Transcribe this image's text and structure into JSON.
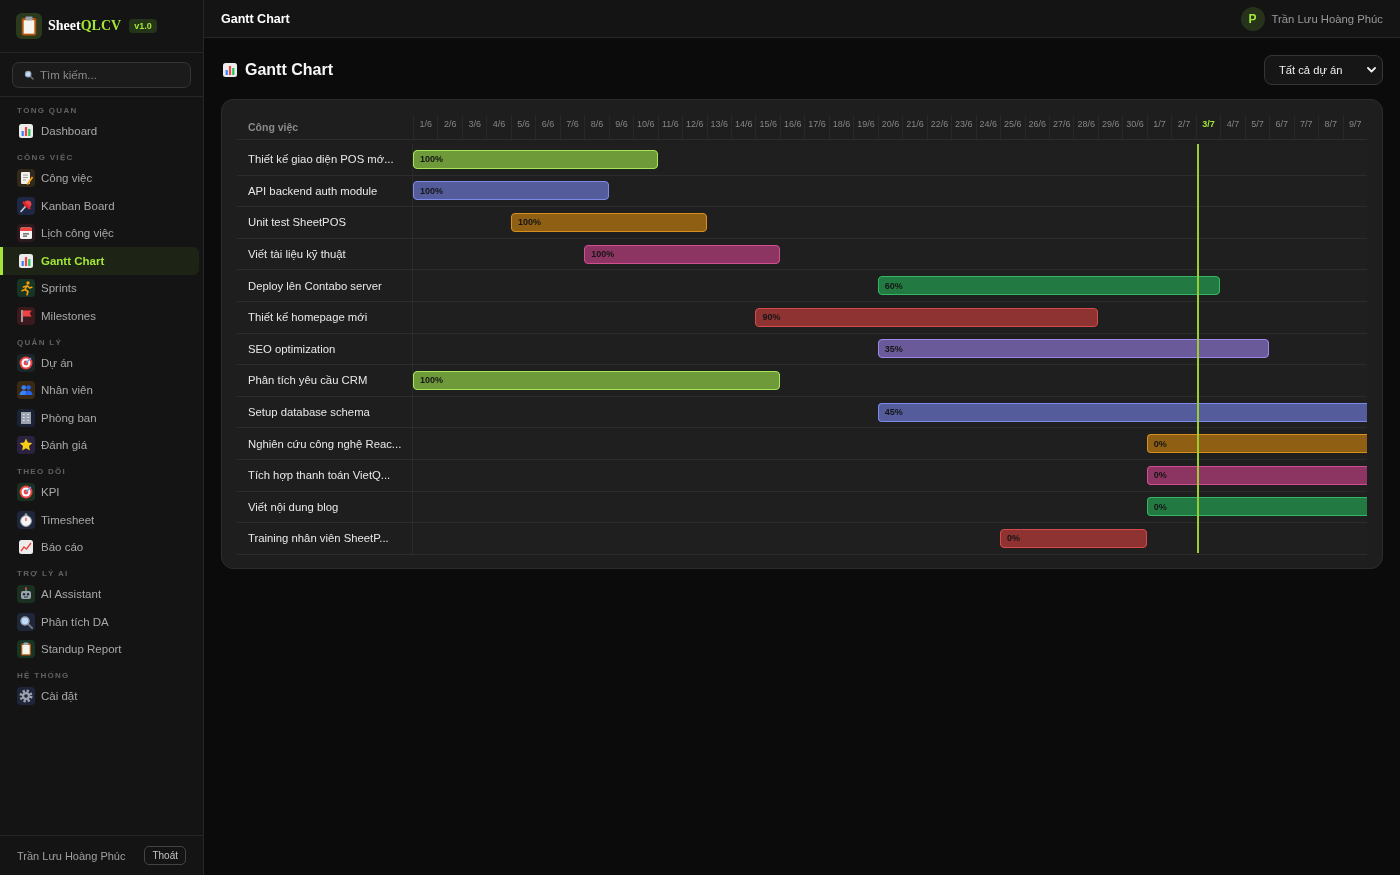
{
  "sidebar": {
    "brand": {
      "name": "Sheet",
      "accent": "QLCV",
      "version": "v1.0"
    },
    "search": {
      "placeholder": "Tìm kiếm..."
    },
    "sections": [
      {
        "title": "TỔNG QUAN",
        "items": [
          {
            "label": "Dashboard",
            "selected": false
          }
        ]
      },
      {
        "title": "CÔNG VIỆC",
        "items": [
          {
            "label": "Công việc",
            "selected": false
          },
          {
            "label": "Kanban Board",
            "selected": false
          },
          {
            "label": "Lịch công việc",
            "selected": false
          },
          {
            "label": "Gantt Chart",
            "selected": true
          },
          {
            "label": "Sprints",
            "selected": false
          },
          {
            "label": "Milestones",
            "selected": false
          }
        ]
      },
      {
        "title": "QUẢN LÝ",
        "items": [
          {
            "label": "Dự án",
            "selected": false
          },
          {
            "label": "Nhân viên",
            "selected": false
          },
          {
            "label": "Phòng ban",
            "selected": false
          },
          {
            "label": "Đánh giá",
            "selected": false
          }
        ]
      },
      {
        "title": "THEO DÕI",
        "items": [
          {
            "label": "KPI",
            "selected": false
          },
          {
            "label": "Timesheet",
            "selected": false
          },
          {
            "label": "Báo cáo",
            "selected": false
          }
        ]
      },
      {
        "title": "TRỢ LÝ AI",
        "items": [
          {
            "label": "AI Assistant",
            "selected": false
          },
          {
            "label": "Phân tích DA",
            "selected": false
          },
          {
            "label": "Standup Report",
            "selected": false
          }
        ]
      },
      {
        "title": "HỆ THỐNG",
        "items": [
          {
            "label": "Cài đặt",
            "selected": false
          }
        ]
      }
    ],
    "user": {
      "name": "Trần Lưu Hoàng Phúc",
      "logout": "Thoát"
    }
  },
  "topbar": {
    "title": "Gantt Chart",
    "user": {
      "initial": "P",
      "name": "Trần Lưu Hoàng Phúc"
    }
  },
  "page": {
    "title": "Gantt Chart",
    "project_filter": {
      "value": "Tất cả dự án"
    }
  },
  "gantt": {
    "task_column": "Công việc",
    "days": [
      {
        "label": "1/6",
        "today": false
      },
      {
        "label": "2/6",
        "today": false
      },
      {
        "label": "3/6",
        "today": false
      },
      {
        "label": "4/6",
        "today": false
      },
      {
        "label": "5/6",
        "today": false
      },
      {
        "label": "6/6",
        "today": false
      },
      {
        "label": "7/6",
        "today": false
      },
      {
        "label": "8/6",
        "today": false
      },
      {
        "label": "9/6",
        "today": false
      },
      {
        "label": "10/6",
        "today": false
      },
      {
        "label": "11/6",
        "today": false
      },
      {
        "label": "12/6",
        "today": false
      },
      {
        "label": "13/6",
        "today": false
      },
      {
        "label": "14/6",
        "today": false
      },
      {
        "label": "15/6",
        "today": false
      },
      {
        "label": "16/6",
        "today": false
      },
      {
        "label": "17/6",
        "today": false
      },
      {
        "label": "18/6",
        "today": false
      },
      {
        "label": "19/6",
        "today": false
      },
      {
        "label": "20/6",
        "today": false
      },
      {
        "label": "21/6",
        "today": false
      },
      {
        "label": "22/6",
        "today": false
      },
      {
        "label": "23/6",
        "today": false
      },
      {
        "label": "24/6",
        "today": false
      },
      {
        "label": "25/6",
        "today": false
      },
      {
        "label": "26/6",
        "today": false
      },
      {
        "label": "27/6",
        "today": false
      },
      {
        "label": "28/6",
        "today": false
      },
      {
        "label": "29/6",
        "today": false
      },
      {
        "label": "30/6",
        "today": false
      },
      {
        "label": "1/7",
        "today": false
      },
      {
        "label": "2/7",
        "today": false
      },
      {
        "label": "3/7",
        "today": true
      },
      {
        "label": "4/7",
        "today": false
      },
      {
        "label": "5/7",
        "today": false
      },
      {
        "label": "6/7",
        "today": false
      },
      {
        "label": "7/7",
        "today": false
      },
      {
        "label": "8/7",
        "today": false
      },
      {
        "label": "9/7",
        "today": false
      }
    ],
    "tasks": [
      {
        "name": "Thiết kế giao diện POS mớ...",
        "progress": "100%",
        "color": "#6e9a3a",
        "start": {
          "level": 0
        },
        "end": {
          "level": 0.2564
        }
      },
      {
        "name": "API backend auth module",
        "progress": "100%",
        "color": "#545c9c",
        "start": {
          "level": 0
        },
        "end": {
          "level": 0.2051
        }
      },
      {
        "name": "Unit test SheetPOS",
        "progress": "100%",
        "color": "#8f5f13",
        "start": {
          "level": 0.1026
        },
        "end": {
          "level": 0.3077
        }
      },
      {
        "name": "Viết tài liệu kỹ thuật",
        "progress": "100%",
        "color": "#8c3462",
        "start": {
          "level": 0.1795
        },
        "end": {
          "level": 0.3846
        }
      },
      {
        "name": "Deploy lên Contabo server",
        "progress": "60%",
        "color": "#227a42",
        "start": {
          "level": 0.4872
        },
        "end": {
          "level": 0.8462
        }
      },
      {
        "name": "Thiết kế homepage mới",
        "progress": "90%",
        "color": "#8e3232",
        "start": {
          "level": 0.359
        },
        "end": {
          "level": 0.7179
        }
      },
      {
        "name": "SEO optimization",
        "progress": "35%",
        "color": "#6a5a9a",
        "start": {
          "level": 0.4872
        },
        "end": {
          "level": 0.8974
        }
      },
      {
        "name": "Phân tích yêu cầu CRM",
        "progress": "100%",
        "color": "#6e9a3a",
        "start": {
          "level": 0
        },
        "end": {
          "level": 0.3846
        }
      },
      {
        "name": "Setup database schema",
        "progress": "45%",
        "color": "#545c9c",
        "start": {
          "level": 0.4872
        }
      },
      {
        "name": "Nghiên cứu công nghệ Reac...",
        "progress": "0%",
        "color": "#8f5f13",
        "start": {
          "level": 0.7692
        }
      },
      {
        "name": "Tích hợp thanh toán VietQ...",
        "progress": "0%",
        "color": "#8c3462",
        "start": {
          "level": 0.7692
        }
      },
      {
        "name": "Viết nội dung blog",
        "progress": "0%",
        "color": "#227a42",
        "start": {
          "level": 0.7692
        }
      },
      {
        "name": "Training nhân viên SheetP...",
        "progress": "0%",
        "color": "#8e3232",
        "start": {
          "level": 0.6154
        },
        "end": {
          "level": 0.7692
        }
      }
    ]
  }
}
